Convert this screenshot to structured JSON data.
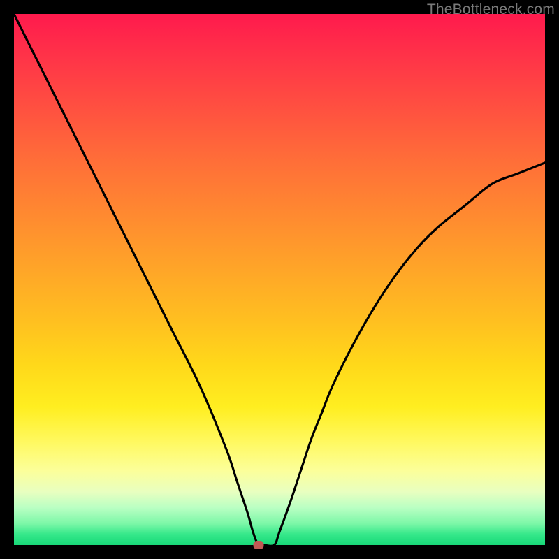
{
  "watermark": "TheBottleneck.com",
  "chart_data": {
    "type": "line",
    "title": "",
    "xlabel": "",
    "ylabel": "",
    "xlim": [
      0,
      100
    ],
    "ylim": [
      0,
      100
    ],
    "series": [
      {
        "name": "curve",
        "x": [
          0,
          5,
          10,
          15,
          20,
          25,
          30,
          35,
          40,
          42,
          44,
          45,
          46,
          47,
          49,
          50,
          52,
          54,
          56,
          58,
          60,
          64,
          68,
          72,
          76,
          80,
          85,
          90,
          95,
          100
        ],
        "values": [
          100,
          90,
          80,
          70,
          60,
          50,
          40,
          30,
          18,
          12,
          6,
          2.5,
          0,
          0,
          0,
          2.5,
          8,
          14,
          20,
          25,
          30,
          38,
          45,
          51,
          56,
          60,
          64,
          68,
          70,
          72
        ]
      }
    ],
    "marker": {
      "x": 46,
      "y": 0,
      "color": "#c05a55"
    },
    "colors": {
      "curve": "#000000",
      "gradient_top": "#ff1a4d",
      "gradient_bottom": "#18d878"
    }
  }
}
